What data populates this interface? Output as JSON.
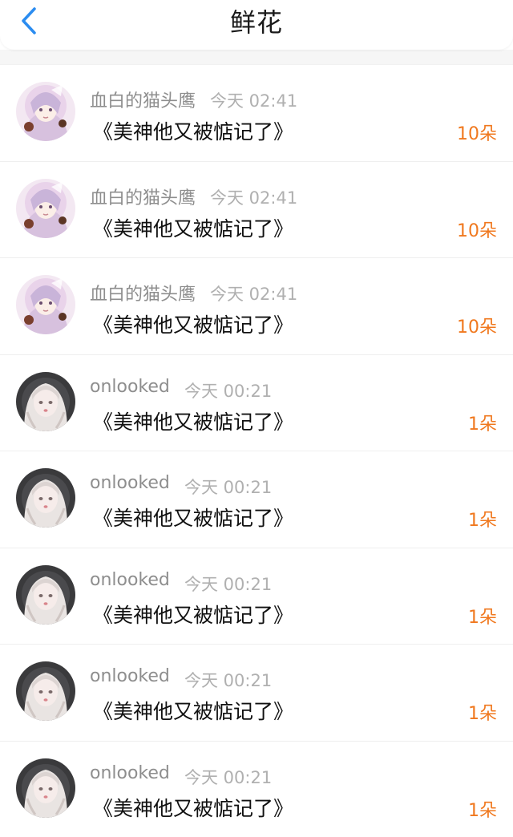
{
  "header": {
    "title": "鲜花",
    "back_icon": "chevron-left-icon",
    "accent_color": "#2b8cf0"
  },
  "items": [
    {
      "user": "血白的猫头鹰",
      "time": "今天 02:41",
      "book": "《美神他又被惦记了》",
      "flowers": "10朵",
      "avatar": "anime-girl-purple"
    },
    {
      "user": "血白的猫头鹰",
      "time": "今天 02:41",
      "book": "《美神他又被惦记了》",
      "flowers": "10朵",
      "avatar": "anime-girl-purple"
    },
    {
      "user": "血白的猫头鹰",
      "time": "今天 02:41",
      "book": "《美神他又被惦记了》",
      "flowers": "10朵",
      "avatar": "anime-girl-purple"
    },
    {
      "user": "onlooked",
      "time": "今天 00:21",
      "book": "《美神他又被惦记了》",
      "flowers": "1朵",
      "avatar": "anime-girl-pale"
    },
    {
      "user": "onlooked",
      "time": "今天 00:21",
      "book": "《美神他又被惦记了》",
      "flowers": "1朵",
      "avatar": "anime-girl-pale"
    },
    {
      "user": "onlooked",
      "time": "今天 00:21",
      "book": "《美神他又被惦记了》",
      "flowers": "1朵",
      "avatar": "anime-girl-pale"
    },
    {
      "user": "onlooked",
      "time": "今天 00:21",
      "book": "《美神他又被惦记了》",
      "flowers": "1朵",
      "avatar": "anime-girl-pale"
    },
    {
      "user": "onlooked",
      "time": "今天 00:21",
      "book": "《美神他又被惦记了》",
      "flowers": "1朵",
      "avatar": "anime-girl-pale"
    }
  ]
}
